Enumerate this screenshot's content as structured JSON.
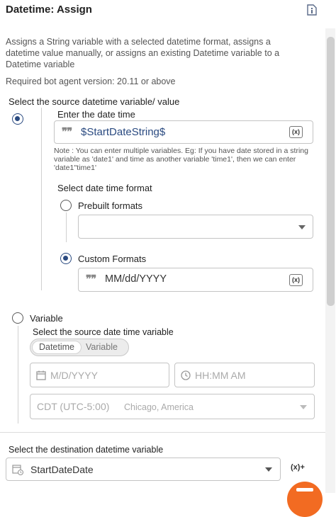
{
  "header": {
    "title": "Datetime: Assign",
    "doc_icon": "document-info-icon"
  },
  "description": "Assigns a String variable with a selected datetime format, assigns a datetime value manually, or assigns an existing Datetime variable to a Datetime variable",
  "required_version": "Required bot agent version: 20.11 or above",
  "source": {
    "label": "Select the source datetime variable/ value",
    "manual": {
      "selected": true,
      "label": "Enter the date time",
      "value": "$StartDateString$",
      "var_badge": "(x)",
      "note": "Note : You can enter multiple variables. Eg: If you have date stored in a string variable as 'date1' and time as another variable 'time1', then we can enter 'date1''time1'",
      "format_label": "Select date time format",
      "prebuilt": {
        "label": "Prebuilt formats",
        "selected": false,
        "value": ""
      },
      "custom": {
        "label": "Custom Formats",
        "selected": true,
        "value": "MM/dd/YYYY",
        "var_badge": "(x)"
      }
    },
    "variable": {
      "selected": false,
      "label": "Variable",
      "sub_label": "Select the source date time variable",
      "toggle": [
        "Datetime",
        "Variable"
      ],
      "toggle_active": "Datetime",
      "date_placeholder": "M/D/YYYY",
      "time_placeholder": "HH:MM AM",
      "timezone": "CDT (UTC-5:00)",
      "timezone_city": "Chicago, America"
    }
  },
  "destination": {
    "label": "Select the destination datetime variable",
    "value": "StartDateDate",
    "add_var_badge": "(x)+"
  },
  "colors": {
    "accent": "#2a4a80",
    "fab": "#f26b22"
  }
}
